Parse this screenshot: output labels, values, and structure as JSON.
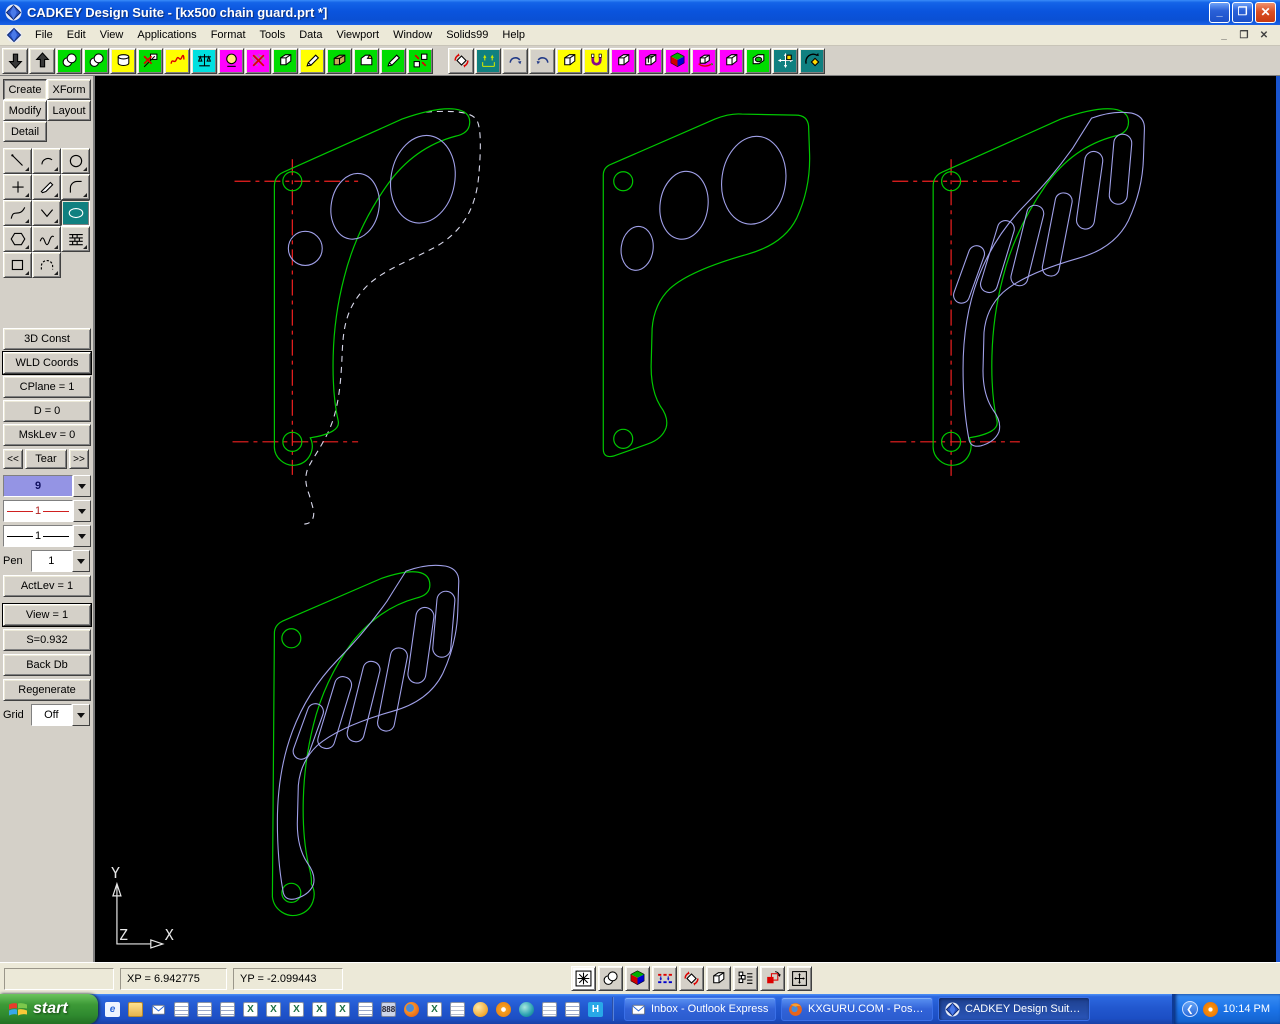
{
  "window": {
    "title": "CADKEY Design Suite - [kx500 chain guard.prt *]",
    "controls": [
      "minimize-icon",
      "restore-icon",
      "close-icon"
    ]
  },
  "menu": {
    "items": [
      "File",
      "Edit",
      "View",
      "Applications",
      "Format",
      "Tools",
      "Data",
      "Viewport",
      "Window",
      "Solids99",
      "Help"
    ]
  },
  "toolbar": {
    "icons": [
      "level-down",
      "level-up",
      "entity-select",
      "entity-copy",
      "solid-cylinder",
      "delete-flag",
      "freehand-redline",
      "measure-balance",
      "render-sphere",
      "delete-redline",
      "wireframe-cube",
      "pencil-eraser",
      "solid-box",
      "solid-round",
      "pencil-edit",
      "copy-entities",
      "dynamic-rotate",
      "vertical-dimension",
      "redo",
      "undo",
      "isometric-cube",
      "magnet-snap",
      "solid-view",
      "cube-sections",
      "shaded-rgb-cube",
      "rotate-view",
      "plain-cube",
      "hollow-cube",
      "pan-arrows",
      "orbit-cube"
    ]
  },
  "sidebar": {
    "modes": [
      "Create",
      "XForm",
      "Modify",
      "Layout",
      "Detail"
    ],
    "tools": [
      "line-tool",
      "arc-tool",
      "circle-tool",
      "point-tool",
      "sketch-tool",
      "fillet-tool",
      "conic-tool",
      "chamfer-tool",
      "ellipse-tool",
      "polygon-tool",
      "spline-tool",
      "hatch-tool",
      "rectangle-tool",
      "arch-tool"
    ],
    "status_buttons": [
      "3D Const",
      "WLD Coords",
      "CPlane = 1",
      "D = 0",
      "MskLev = 0"
    ],
    "tear": {
      "left": "<<",
      "label": "Tear",
      "right": ">>"
    },
    "combos": {
      "color": "9",
      "line_style": "1",
      "line_width": "1",
      "pen_label": "Pen",
      "pen": "1",
      "grid_label": "Grid",
      "grid": "Off"
    },
    "buttons": {
      "actlev": "ActLev = 1",
      "view": "View = 1",
      "scale": "S=0.932",
      "backdb": "Back Db",
      "regenerate": "Regenerate"
    }
  },
  "canvas": {
    "axis": {
      "x": "X",
      "y": "Y",
      "z": "Z"
    }
  },
  "statusbar": {
    "prompt": "",
    "xp": "XP = 6.942775",
    "yp": "YP = -2.099443",
    "icons": [
      "snap-grid",
      "select-circles",
      "shaded-view",
      "dimension-marks",
      "rotate-gnomon",
      "cube-view",
      "chain-select",
      "copy-rotate",
      "fit-view"
    ]
  },
  "taskbar": {
    "start": "start",
    "quick_launch": [
      "internet-explorer",
      "folder",
      "outlook-express",
      "notepad-1",
      "notepad-2",
      "notepad-3",
      "excel-1",
      "excel-2",
      "excel-3",
      "excel-4",
      "excel-5",
      "notepad-4",
      "calculator",
      "firefox",
      "excel-web",
      "document-1",
      "powerpoint",
      "norton-clock",
      "globe",
      "document-2",
      "notepad-5",
      "help-viewer"
    ],
    "tasks": [
      "Inbox - Outlook Express",
      "KXGURU.COM - Post ...",
      "CADKEY Design Suite ..."
    ],
    "clock": "10:14 PM"
  },
  "colors": {
    "cad_green": "#00c800",
    "cad_lavender": "#a0a0e8",
    "cad_red": "#f02020",
    "canvas_bg": "#000000",
    "titlebar_blue": "#0a54dd",
    "taskbar_blue": "#2258cf",
    "start_green": "#2f8a2f",
    "selected_tool_teal": "#108080",
    "color_swatch": "#9494e4"
  }
}
